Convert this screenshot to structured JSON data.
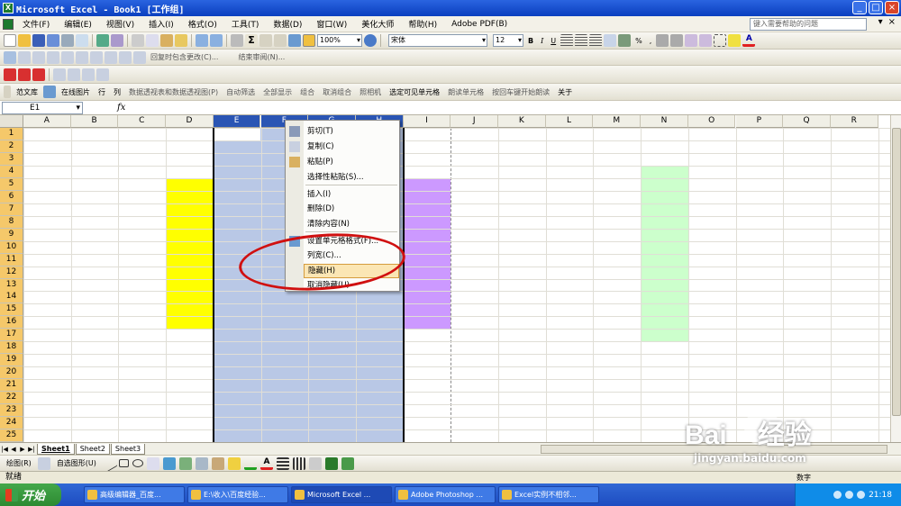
{
  "window": {
    "title": "Microsoft Excel - Book1  [工作组]",
    "controls": [
      "_",
      "□",
      "×"
    ]
  },
  "menu": {
    "items": [
      "文件(F)",
      "编辑(E)",
      "视图(V)",
      "插入(I)",
      "格式(O)",
      "工具(T)",
      "数据(D)",
      "窗口(W)",
      "美化大师",
      "帮助(H)",
      "Adobe PDF(B)"
    ],
    "help_placeholder": "键入需要帮助的问题"
  },
  "toolbar1": {
    "zoom": "100%",
    "font": "宋体",
    "size": "12",
    "bold": "B",
    "italic": "I",
    "underline": "U",
    "percent": "%",
    "comma": ","
  },
  "toolbar2": {
    "reply": "回复时包含更改(C)...",
    "end_review": "结束审阅(N)..."
  },
  "toolbar4": {
    "items": [
      "范文库",
      "在线图片",
      "行",
      "列",
      "数据透视表和数据透视图(P)",
      "自动筛选",
      "全部显示",
      "组合",
      "取消组合",
      "照相机",
      "选定可见单元格",
      "朗读单元格",
      "按回车键开始朗读",
      "关于"
    ]
  },
  "formula_bar": {
    "name_box": "E1",
    "fx": "fx"
  },
  "grid": {
    "columns": [
      "A",
      "B",
      "C",
      "D",
      "E",
      "F",
      "G",
      "H",
      "I",
      "J",
      "K",
      "L",
      "M",
      "N",
      "O",
      "P",
      "Q",
      "R"
    ],
    "selected_columns": [
      "E",
      "F",
      "G",
      "H"
    ],
    "rows": [
      "1",
      "2",
      "3",
      "4",
      "5",
      "6",
      "7",
      "8",
      "9",
      "10",
      "11",
      "12",
      "13",
      "14",
      "15",
      "16",
      "17",
      "18",
      "19",
      "20",
      "21",
      "22",
      "23",
      "24",
      "25"
    ],
    "fills": [
      {
        "column": "D",
        "rows": "5-16",
        "color": "#ffff00"
      },
      {
        "column": "I",
        "rows": "5-16",
        "color": "#cc99ff"
      },
      {
        "column": "N",
        "rows": "4-17",
        "color": "#ccffcc"
      },
      {
        "column": "E-H",
        "rows": "1-25",
        "color": "#b9c8e6"
      }
    ]
  },
  "context_menu": {
    "items": [
      "剪切(T)",
      "复制(C)",
      "粘贴(P)",
      "选择性粘贴(S)...",
      "插入(I)",
      "删除(D)",
      "清除内容(N)",
      "设置单元格格式(F)...",
      "列宽(C)...",
      "隐藏(H)",
      "取消隐藏(U)"
    ],
    "highlighted": "隐藏(H)"
  },
  "sheets": {
    "tabs": [
      "Sheet1",
      "Sheet2",
      "Sheet3"
    ],
    "active": "Sheet1"
  },
  "drawbar": {
    "draw": "绘图(R)",
    "autoshape": "自选图形(U)"
  },
  "status": {
    "text": "就绪",
    "mode": "数字"
  },
  "taskbar": {
    "start": "开始",
    "tasks": [
      "高级编辑器_百度...",
      "E:\\收入\\百度经验...",
      "Microsoft Excel ...",
      "Adobe Photoshop ...",
      "Excel实例不相邻..."
    ],
    "active_index": 2,
    "time": "21:18"
  },
  "watermark": {
    "brand": "Bai",
    "brand2": "经验",
    "url": "jingyan.baidu.com"
  },
  "colors": {
    "selection": "#b9c8e6",
    "header_selected": "#2a55b4",
    "annotation": "#d01010"
  }
}
